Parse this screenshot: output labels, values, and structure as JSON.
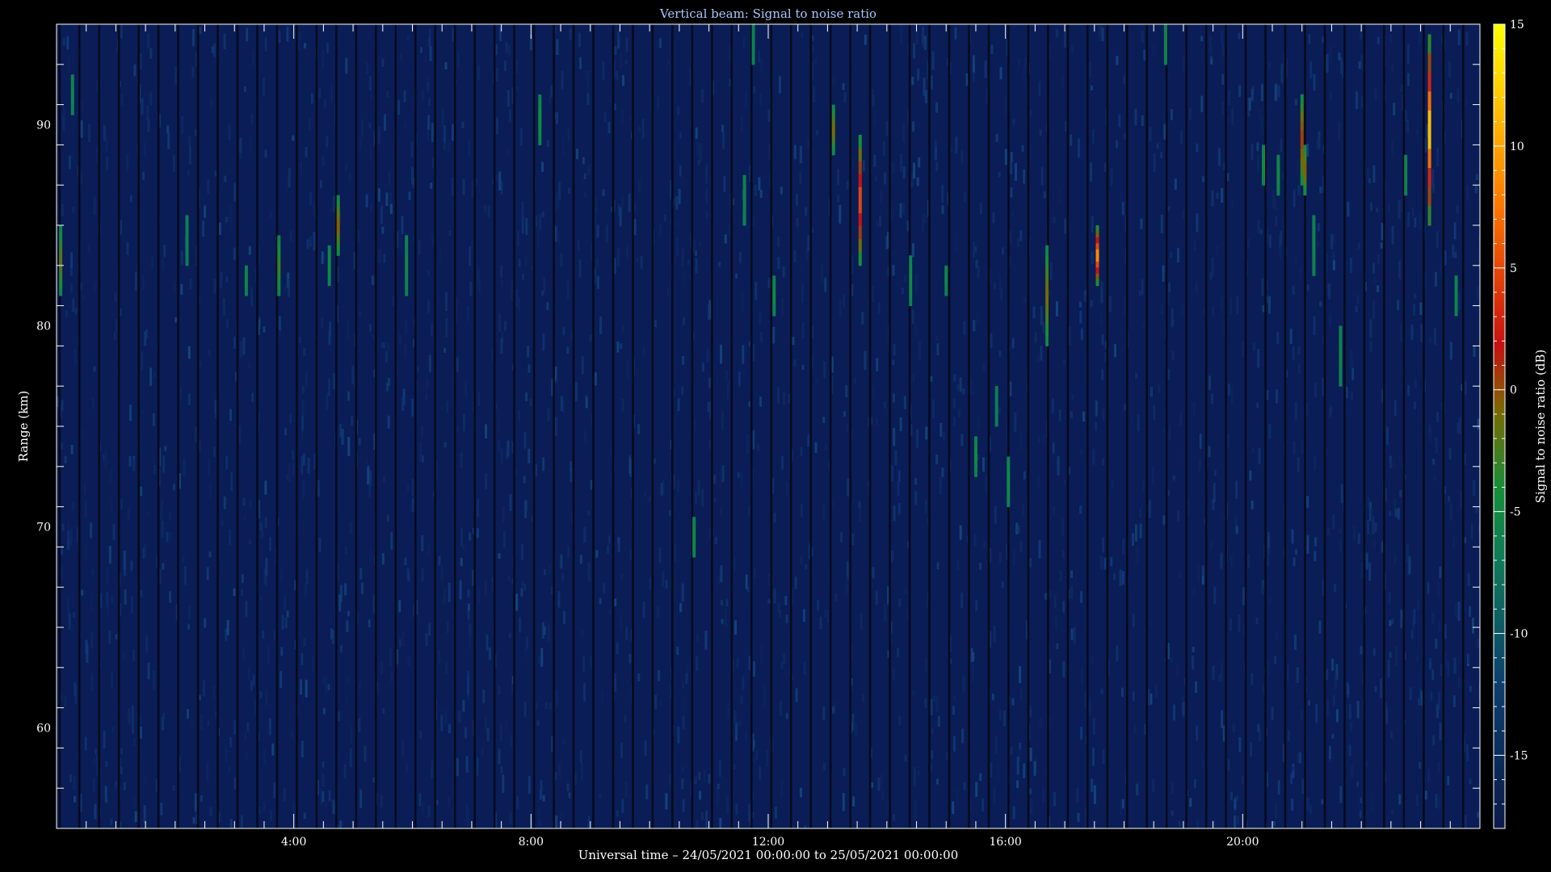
{
  "chart_data": {
    "type": "heatmap",
    "title": "Vertical beam: Signal to noise ratio",
    "xlabel": "Universal time – 24/05/2021 00:00:00 to 25/05/2021 00:00:00",
    "ylabel": "Range (km)",
    "colorbar_label": "Signal to noise ratio (dB)",
    "x_range_hours": [
      0,
      24
    ],
    "ylim": [
      55,
      95
    ],
    "color_range_db": [
      -18,
      15
    ],
    "x_tick_labels": [
      {
        "hour": 4,
        "label": "4:00"
      },
      {
        "hour": 8,
        "label": "8:00"
      },
      {
        "hour": 12,
        "label": "12:00"
      },
      {
        "hour": 16,
        "label": "16:00"
      },
      {
        "hour": 20,
        "label": "20:00"
      }
    ],
    "y_ticks": [
      60,
      70,
      80,
      90
    ],
    "colorbar_ticks": [
      15,
      10,
      5,
      0,
      -5,
      -10,
      -15
    ],
    "colormap": [
      "#0b1a4a",
      "#0b3f6e",
      "#0e7a5a",
      "#138f3a",
      "#7a6a00",
      "#c81010",
      "#ff7a00",
      "#ffff00"
    ],
    "background_color": "#0a1d56",
    "echoes": [
      {
        "hour": 0.07,
        "range_from": 81.5,
        "range_to": 85,
        "max_snr_db": 0
      },
      {
        "hour": 0.27,
        "range_from": 90.5,
        "range_to": 92.5,
        "max_snr_db": -6
      },
      {
        "hour": 2.2,
        "range_from": 83,
        "range_to": 85.5,
        "max_snr_db": -8
      },
      {
        "hour": 3.2,
        "range_from": 81.5,
        "range_to": 83,
        "max_snr_db": -6
      },
      {
        "hour": 3.75,
        "range_from": 81.5,
        "range_to": 84.5,
        "max_snr_db": -2
      },
      {
        "hour": 4.6,
        "range_from": 82,
        "range_to": 84,
        "max_snr_db": -5
      },
      {
        "hour": 4.75,
        "range_from": 83.5,
        "range_to": 86.5,
        "max_snr_db": 2
      },
      {
        "hour": 5.9,
        "range_from": 81.5,
        "range_to": 84.5,
        "max_snr_db": -6
      },
      {
        "hour": 8.15,
        "range_from": 89,
        "range_to": 91.5,
        "max_snr_db": -4
      },
      {
        "hour": 10.75,
        "range_from": 68.5,
        "range_to": 70.5,
        "max_snr_db": -5
      },
      {
        "hour": 11.6,
        "range_from": 85,
        "range_to": 87.5,
        "max_snr_db": -7
      },
      {
        "hour": 11.75,
        "range_from": 93,
        "range_to": 95,
        "max_snr_db": -7
      },
      {
        "hour": 12.1,
        "range_from": 80.5,
        "range_to": 82.5,
        "max_snr_db": -5
      },
      {
        "hour": 13.1,
        "range_from": 88.5,
        "range_to": 91,
        "max_snr_db": 1
      },
      {
        "hour": 13.55,
        "range_from": 83,
        "range_to": 89.5,
        "max_snr_db": 9
      },
      {
        "hour": 14.4,
        "range_from": 81,
        "range_to": 83.5,
        "max_snr_db": -5
      },
      {
        "hour": 15.0,
        "range_from": 81.5,
        "range_to": 83,
        "max_snr_db": -6
      },
      {
        "hour": 15.5,
        "range_from": 72.5,
        "range_to": 74.5,
        "max_snr_db": -5
      },
      {
        "hour": 15.85,
        "range_from": 75,
        "range_to": 77,
        "max_snr_db": -8
      },
      {
        "hour": 16.05,
        "range_from": 71,
        "range_to": 73.5,
        "max_snr_db": -5
      },
      {
        "hour": 16.7,
        "range_from": 79,
        "range_to": 84,
        "max_snr_db": 1
      },
      {
        "hour": 17.55,
        "range_from": 82,
        "range_to": 85,
        "max_snr_db": 12
      },
      {
        "hour": 18.7,
        "range_from": 93,
        "range_to": 95,
        "max_snr_db": -6
      },
      {
        "hour": 20.35,
        "range_from": 87,
        "range_to": 89,
        "max_snr_db": -5
      },
      {
        "hour": 20.6,
        "range_from": 86.5,
        "range_to": 88.5,
        "max_snr_db": -5
      },
      {
        "hour": 21.0,
        "range_from": 87,
        "range_to": 91.5,
        "max_snr_db": 4
      },
      {
        "hour": 21.05,
        "range_from": 86.5,
        "range_to": 89,
        "max_snr_db": 2
      },
      {
        "hour": 21.2,
        "range_from": 82.5,
        "range_to": 85.5,
        "max_snr_db": -6
      },
      {
        "hour": 21.65,
        "range_from": 77,
        "range_to": 80,
        "max_snr_db": -6
      },
      {
        "hour": 22.75,
        "range_from": 86.5,
        "range_to": 88.5,
        "max_snr_db": -6
      },
      {
        "hour": 23.15,
        "range_from": 85,
        "range_to": 94.5,
        "max_snr_db": 14
      },
      {
        "hour": 23.6,
        "range_from": 80.5,
        "range_to": 82.5,
        "max_snr_db": -6
      }
    ]
  }
}
